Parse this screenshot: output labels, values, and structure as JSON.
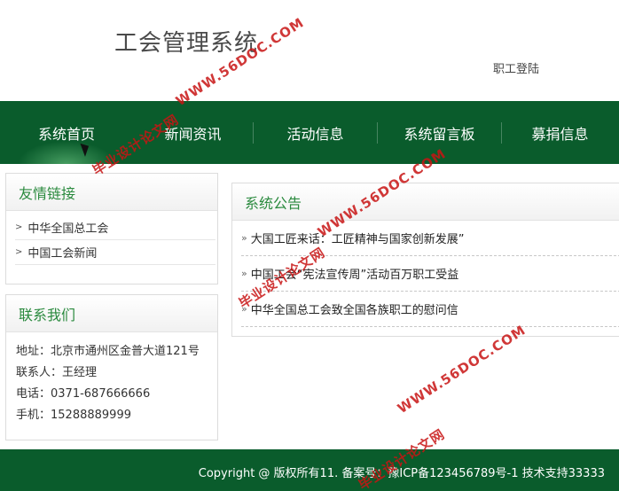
{
  "header": {
    "title": "工会管理系统",
    "login": "职工登陆"
  },
  "nav": {
    "items": [
      {
        "label": "系统首页"
      },
      {
        "label": "新闻资讯"
      },
      {
        "label": "活动信息"
      },
      {
        "label": "系统留言板"
      },
      {
        "label": "募捐信息"
      }
    ]
  },
  "links": {
    "title": "友情链接",
    "items": [
      "中华全国总工会",
      "中国工会新闻"
    ]
  },
  "contact": {
    "title": "联系我们",
    "address": "地址：北京市通州区金普大道121号",
    "person": "联系人：王经理",
    "phone": "电话：0371-687666666",
    "mobile": "手机：15288889999"
  },
  "notices": {
    "title": "系统公告",
    "items": [
      "大国工匠来话：工匠精神与国家创新发展”",
      "中国工会“宪法宣传周”活动百万职工受益",
      "中华全国总工会致全国各族职工的慰问信"
    ]
  },
  "footer": {
    "text": "Copyright @ 版权所有11. 备案号：豫ICP备123456789号-1    技术支持33333"
  },
  "watermark": {
    "site": "WWW.56DOC.COM",
    "cn": "毕业设计论文网"
  },
  "colors": {
    "primary_green": "#0a5c2c",
    "title_green": "#2a8a3e",
    "watermark_red": "#c81414"
  }
}
